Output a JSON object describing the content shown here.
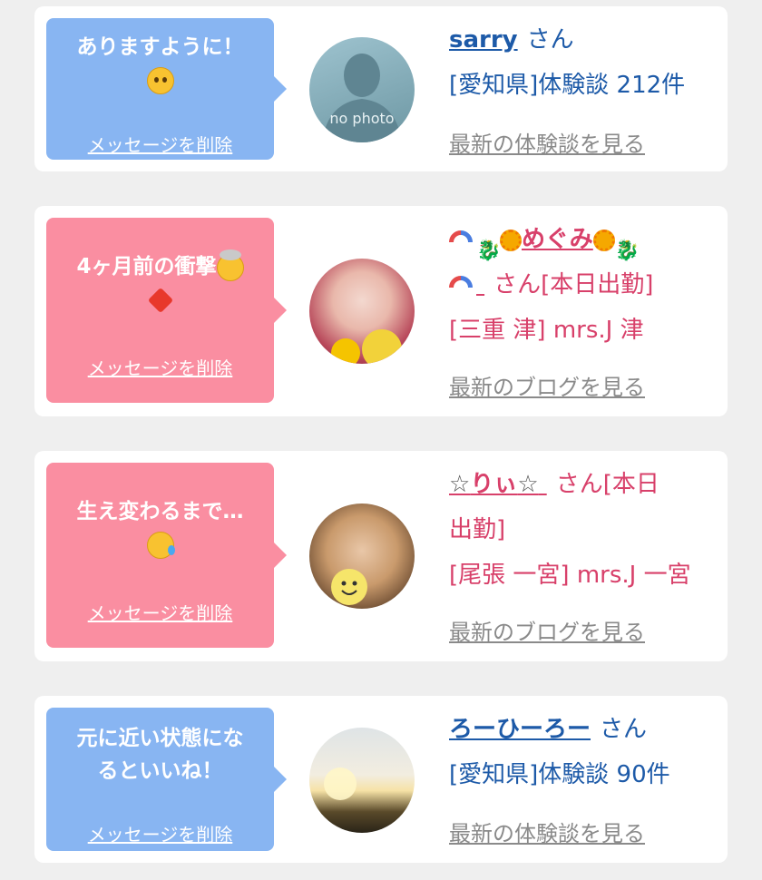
{
  "cards": [
    {
      "message": "ありますように！",
      "delete_label": "メッセージを削除",
      "avatar_text": "no photo",
      "name": "sarry",
      "honorific": "さん",
      "detail": "[愛知県]体験談 212件",
      "link": "最新の体験談を見る"
    },
    {
      "message": "4ヶ月前の衝撃",
      "delete_label": "メッセージを削除",
      "name": "めぐみ",
      "honorific": "さん[本日出勤]",
      "detail": "[三重 津] mrs.J 津",
      "link": "最新のブログを見る"
    },
    {
      "message": "生え変わるまで…",
      "delete_label": "メッセージを削除",
      "name": "りぃ",
      "honorific_line1": "さん[本日",
      "honorific_line2": "出勤]",
      "detail": "[尾張 一宮] mrs.J 一宮",
      "link": "最新のブログを見る"
    },
    {
      "message_line1": "元に近い状態にな",
      "message_line2": "るといいね！",
      "delete_label": "メッセージを削除",
      "name": "ろーひーろー",
      "honorific": "さん",
      "detail": "[愛知県]体験談 90件",
      "link": "最新の体験談を見る"
    }
  ],
  "colors": {
    "blue_bubble": "#88b5f2",
    "pink_bubble": "#fa8ea1",
    "blue_text": "#1d5aa8",
    "pink_text": "#d8406a",
    "gray_link": "#8a8a8a"
  }
}
